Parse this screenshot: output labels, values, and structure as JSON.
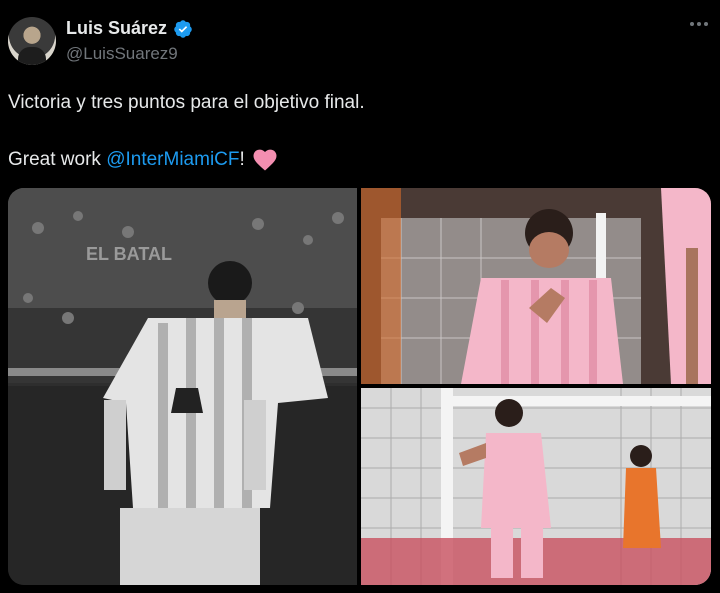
{
  "author": {
    "display_name": "Luis Suárez",
    "handle": "@LuisSuarez9",
    "verified_icon": "verified-badge-icon",
    "verified_color": "#1d9bf0"
  },
  "tweet": {
    "line1": "Victoria y tres puntos para el objetivo final.",
    "line2_prefix": "Great work ",
    "mention": "@InterMiamiCF",
    "line2_suffix": "!",
    "emoji_icon": "pink-heart-icon",
    "heart_color": "#f48fb1"
  },
  "media": {
    "photos": [
      "black-and-white-player-in-stadium",
      "player-celebrating-pink-kit",
      "player-celebrating-near-goal-net"
    ],
    "background_text": "EL BATAL"
  },
  "colors": {
    "background": "#000000",
    "text": "#e7e9ea",
    "secondary": "#71767b",
    "link": "#1d9bf0"
  }
}
